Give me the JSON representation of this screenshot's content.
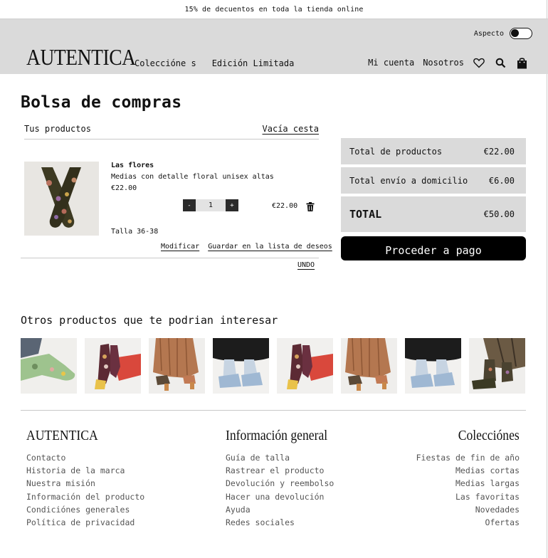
{
  "promo": {
    "text": "15% de decuentos en toda la tienda online"
  },
  "header": {
    "aspect_label": "Aspecto",
    "logo": "AUTENTICA",
    "nav_left": [
      "Coleccióne s",
      "Edición Limitada"
    ],
    "nav_right": [
      "Mi cuenta",
      "Nosotros"
    ],
    "icons": [
      "heart-icon",
      "search-icon",
      "bag-icon"
    ]
  },
  "cart": {
    "title": "Bolsa de compras",
    "products_label": "Tus productos",
    "empty_link": "Vacía cesta",
    "item": {
      "name": "Las flores",
      "description": "Medias con detalle floral unisex altas",
      "price": "€22.00",
      "qty_minus": "-",
      "qty_value": "1",
      "qty_plus": "+",
      "line_total": "€22.00",
      "size": "Talla 36-38",
      "modify": "Modificar",
      "wishlist": "Guardar en la lista de deseos"
    },
    "undo": "UNDO"
  },
  "summary": {
    "products_label": "Total de productos",
    "products_value": "€22.00",
    "shipping_label": "Total envío a domicilio",
    "shipping_value": "€6.00",
    "total_label": "TOTAL",
    "total_value": "€50.00",
    "checkout": "Proceder a pago"
  },
  "recommendations": {
    "title": "Otros productos que te podrian interesar",
    "count": 8
  },
  "footer": {
    "col1": {
      "title": "AUTENTICA",
      "links": [
        "Contacto",
        "Historia de la marca",
        "Nuestra misión",
        "Información del producto",
        "Condiciónes generales",
        "Política de privacidad"
      ]
    },
    "col2": {
      "title": "Información general",
      "links": [
        "Guía de talla",
        "Rastrear el producto",
        "Devolución y reembolso",
        "Hacer una devolución",
        "Ayuda",
        "Redes sociales"
      ]
    },
    "col3": {
      "title": "Colecciónes",
      "links": [
        "Fiestas de fin de año",
        "Medias cortas",
        "Medias largas",
        "Las favoritas",
        "Novedades",
        "Ofertas"
      ]
    }
  }
}
